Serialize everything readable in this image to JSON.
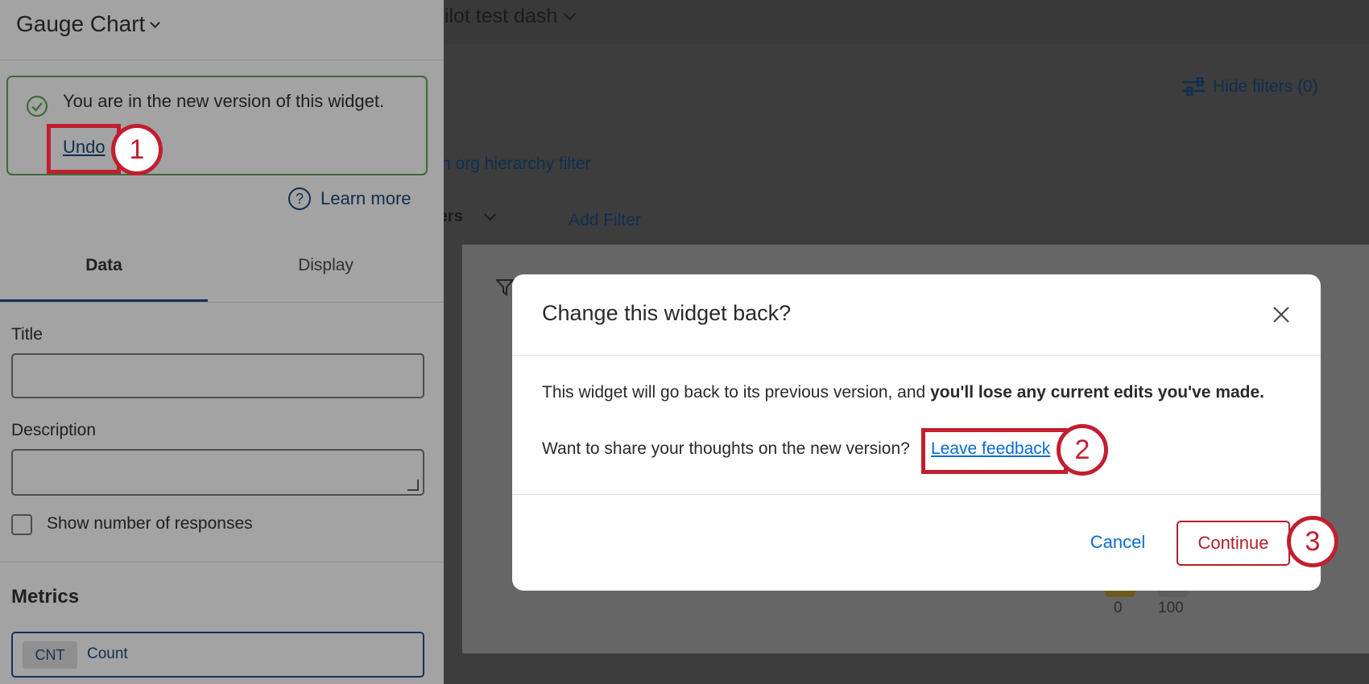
{
  "background": {
    "dashboard_title": "pilot test dash",
    "hide_filters_label": "Hide filters (0)",
    "org_filter_label": "n org hierarchy filter",
    "filters_label": "ters",
    "add_filter_label": "Add Filter",
    "gauge_min": "0",
    "gauge_max": "100"
  },
  "panel": {
    "title": "Gauge Chart",
    "notice_text": "You are in the new version of this widget.",
    "undo_label": "Undo",
    "learn_more_label": "Learn more",
    "help_glyph": "?",
    "tabs": [
      {
        "label": "Data",
        "active": true
      },
      {
        "label": "Display",
        "active": false
      }
    ],
    "title_field_label": "Title",
    "title_field_value": "",
    "description_field_label": "Description",
    "description_field_value": "",
    "show_responses_label": "Show number of responses",
    "show_responses_checked": false,
    "metrics_heading": "Metrics",
    "metric": {
      "badge": "CNT",
      "name": "Count"
    }
  },
  "modal": {
    "title": "Change this widget back?",
    "body_prefix": "This widget will go back to its previous version, and ",
    "body_bold": "you'll lose any current edits you've made.",
    "feedback_prompt": "Want to share your thoughts on the new version?",
    "feedback_link": "Leave feedback",
    "cancel_label": "Cancel",
    "continue_label": "Continue"
  },
  "callouts": [
    {
      "number": "1"
    },
    {
      "number": "2"
    },
    {
      "number": "3"
    }
  ],
  "colors": {
    "callout_red": "#c11f2f",
    "link_blue": "#0a6bd1",
    "continue_red": "#b11e2a",
    "success_green": "#3f6a37"
  }
}
